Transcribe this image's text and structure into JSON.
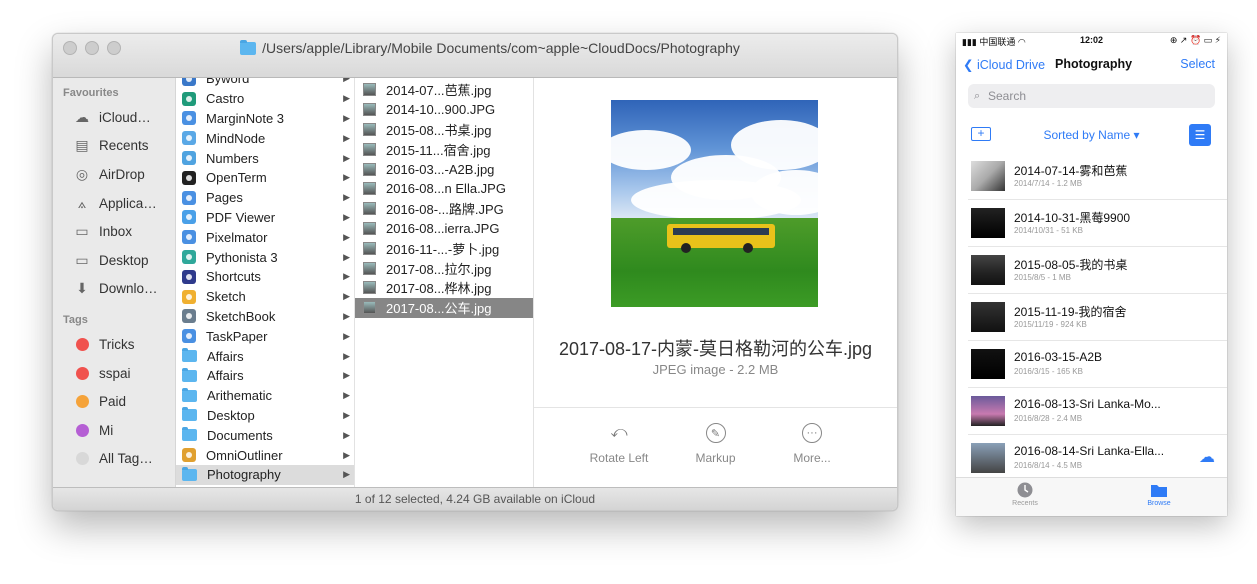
{
  "finder": {
    "path": "/Users/apple/Library/Mobile Documents/com~apple~CloudDocs/Photography",
    "sidebar": {
      "favourites_header": "Favourites",
      "favourites": [
        {
          "label": "iCloud…",
          "icon": "cloud-icon"
        },
        {
          "label": "Recents",
          "icon": "recents-icon"
        },
        {
          "label": "AirDrop",
          "icon": "airdrop-icon"
        },
        {
          "label": "Applica…",
          "icon": "applications-icon"
        },
        {
          "label": "Inbox",
          "icon": "folder-icon"
        },
        {
          "label": "Desktop",
          "icon": "desktop-icon"
        },
        {
          "label": "Downlo…",
          "icon": "downloads-icon"
        }
      ],
      "tags_header": "Tags",
      "tags": [
        {
          "label": "Tricks",
          "color": "#f0524e"
        },
        {
          "label": "sspai",
          "color": "#f0524e"
        },
        {
          "label": "Paid",
          "color": "#f5a33a"
        },
        {
          "label": "Mi",
          "color": "#b55fd4"
        },
        {
          "label": "All Tag…",
          "color": "#d8d8d8"
        }
      ]
    },
    "column1": [
      {
        "label": "Byword",
        "type": "app",
        "color": "#3a78c9"
      },
      {
        "label": "Castro",
        "type": "app",
        "color": "#1f9b7a"
      },
      {
        "label": "MarginNote 3",
        "type": "app",
        "color": "#4a90e2"
      },
      {
        "label": "MindNode",
        "type": "app",
        "color": "#5aa8e6"
      },
      {
        "label": "Numbers",
        "type": "app",
        "color": "#4fa3e0"
      },
      {
        "label": "OpenTerm",
        "type": "app",
        "color": "#222222"
      },
      {
        "label": "Pages",
        "type": "app",
        "color": "#4a90e2"
      },
      {
        "label": "PDF Viewer",
        "type": "app",
        "color": "#4aa0e8"
      },
      {
        "label": "Pixelmator",
        "type": "app",
        "color": "#4a90e2"
      },
      {
        "label": "Pythonista 3",
        "type": "app",
        "color": "#2fa89a"
      },
      {
        "label": "Shortcuts",
        "type": "app",
        "color": "#2e3a8c"
      },
      {
        "label": "Sketch",
        "type": "app",
        "color": "#f0b030"
      },
      {
        "label": "SketchBook",
        "type": "app",
        "color": "#6a7d8e"
      },
      {
        "label": "TaskPaper",
        "type": "app",
        "color": "#4a90e2"
      },
      {
        "label": "Affairs",
        "type": "folder"
      },
      {
        "label": "Affairs",
        "type": "folder"
      },
      {
        "label": "Arithematic",
        "type": "folder"
      },
      {
        "label": "Desktop",
        "type": "folder"
      },
      {
        "label": "Documents",
        "type": "folder"
      },
      {
        "label": "OmniOutliner",
        "type": "app",
        "color": "#e0a030"
      },
      {
        "label": "Photography",
        "type": "folder",
        "highlighted": true
      }
    ],
    "column2": [
      {
        "label": "2014-07...芭蕉.jpg"
      },
      {
        "label": "2014-10...900.JPG"
      },
      {
        "label": "2015-08...书桌.jpg"
      },
      {
        "label": "2015-11...宿舍.jpg"
      },
      {
        "label": "2016-03...-A2B.jpg"
      },
      {
        "label": "2016-08...n Ella.JPG"
      },
      {
        "label": "2016-08-...路牌.JPG"
      },
      {
        "label": "2016-08...ierra.JPG"
      },
      {
        "label": "2016-11-...-萝卜.jpg"
      },
      {
        "label": "2017-08...拉尔.jpg"
      },
      {
        "label": "2017-08...桦林.jpg"
      },
      {
        "label": "2017-08...公车.jpg",
        "selected": true
      }
    ],
    "preview": {
      "filename": "2017-08-17-内蒙-莫日格勒河的公车.jpg",
      "kind": "JPEG image - 2.2 MB",
      "actions": [
        {
          "label": "Rotate Left",
          "icon": "rotate-left-icon"
        },
        {
          "label": "Markup",
          "icon": "markup-icon"
        },
        {
          "label": "More...",
          "icon": "more-icon"
        }
      ]
    },
    "status": "1 of 12 selected, 4.24 GB available on iCloud"
  },
  "phone": {
    "status": {
      "carrier": "中国联通",
      "time": "12:02",
      "right": "⊕ ↗ ⏰ ▭ ⚡"
    },
    "nav": {
      "back": "iCloud Drive",
      "title": "Photography",
      "select": "Select"
    },
    "search_placeholder": "Search",
    "sort_label": "Sorted by Name ▾",
    "items": [
      {
        "name": "2014-07-14-雾和芭蕉",
        "meta": "2014/7/14 - 1.2 MB"
      },
      {
        "name": "2014-10-31-黑莓9900",
        "meta": "2014/10/31 - 51 KB"
      },
      {
        "name": "2015-08-05-我的书桌",
        "meta": "2015/8/5 - 1 MB"
      },
      {
        "name": "2015-11-19-我的宿舍",
        "meta": "2015/11/19 - 924 KB"
      },
      {
        "name": "2016-03-15-A2B",
        "meta": "2016/3/15 - 165 KB"
      },
      {
        "name": "2016-08-13-Sri Lanka-Mo...",
        "meta": "2016/8/28 - 2.4 MB"
      },
      {
        "name": "2016-08-14-Sri Lanka-Ella...",
        "meta": "2016/8/14 - 4.5 MB",
        "cloud": true
      }
    ],
    "tabs": [
      {
        "label": "Recents",
        "active": false
      },
      {
        "label": "Browse",
        "active": true
      }
    ]
  }
}
